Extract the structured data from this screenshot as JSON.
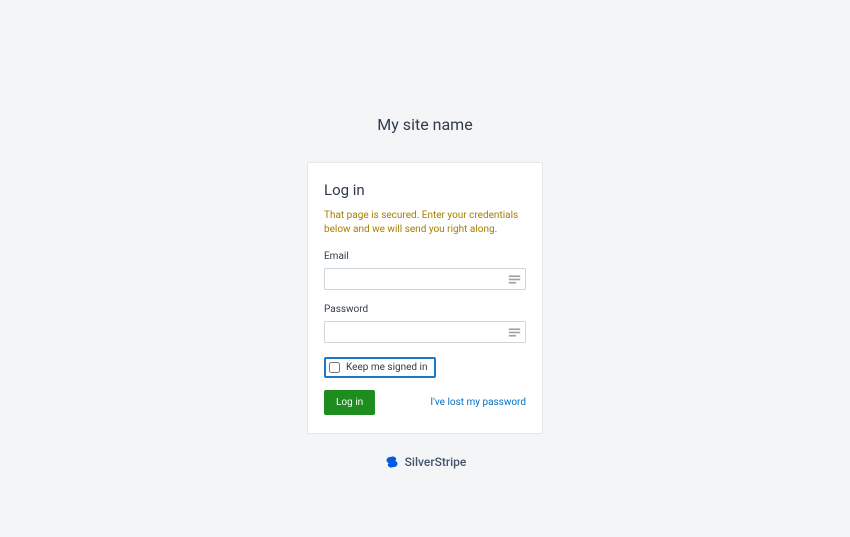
{
  "site": {
    "title": "My site name"
  },
  "login": {
    "heading": "Log in",
    "secured_message": "That page is secured. Enter your credentials below and we will send you right along.",
    "email_label": "Email",
    "email_value": "",
    "password_label": "Password",
    "password_value": "",
    "remember_label": "Keep me signed in",
    "submit_label": "Log in",
    "lost_password_label": "I've lost my password"
  },
  "brand": {
    "name": "SilverStripe"
  },
  "colors": {
    "background": "#f4f5f6",
    "text_primary": "#303b4d",
    "warning_text": "#a47e00",
    "link": "#0071c4",
    "button_bg": "#1e8c1e",
    "focus_ring": "#1a77c9",
    "brand": "#005be0"
  }
}
